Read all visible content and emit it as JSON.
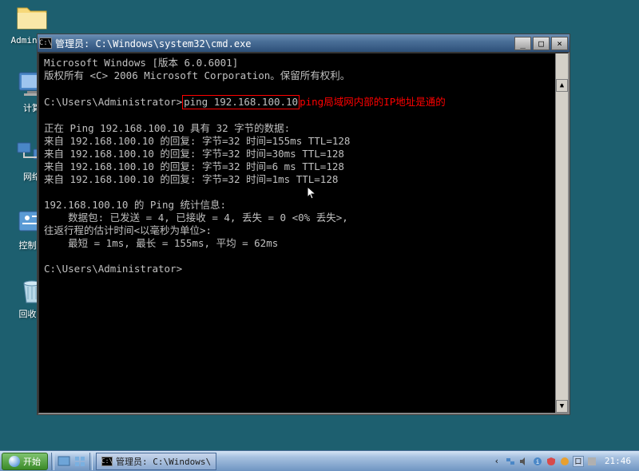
{
  "desktop_icons": [
    {
      "name": "administrator-folder-icon",
      "label": "Administ"
    },
    {
      "name": "computer-icon",
      "label": "计算"
    },
    {
      "name": "network-icon",
      "label": "网络"
    },
    {
      "name": "control-panel-icon",
      "label": "控制面"
    },
    {
      "name": "recycle-bin-icon",
      "label": "回收站"
    }
  ],
  "cmd": {
    "title": "管理员: C:\\Windows\\system32\\cmd.exe",
    "version_line": "Microsoft Windows [版本 6.0.6001]",
    "copyright_line": "版权所有 <C> 2006 Microsoft Corporation。保留所有权利。",
    "prompt1_path": "C:\\Users\\Administrator>",
    "prompt1_cmd": "ping 192.168.100.10",
    "annotation": "ping局域网内部的IP地址是通的",
    "ping_header": "正在 Ping 192.168.100.10 具有 32 字节的数据:",
    "replies": [
      "来自 192.168.100.10 的回复: 字节=32 时间=155ms TTL=128",
      "来自 192.168.100.10 的回复: 字节=32 时间=30ms TTL=128",
      "来自 192.168.100.10 的回复: 字节=32 时间=6 ms TTL=128",
      "来自 192.168.100.10 的回复: 字节=32 时间=1ms TTL=128"
    ],
    "stats_header": "192.168.100.10 的 Ping 统计信息:",
    "stats_packets": "    数据包: 已发送 = 4, 已接收 = 4, 丢失 = 0 <0% 丢失>,",
    "stats_rtt_header": "往返行程的估计时间<以毫秒为单位>:",
    "stats_rtt": "    最短 = 1ms, 最长 = 155ms, 平均 = 62ms",
    "prompt2": "C:\\Users\\Administrator>"
  },
  "window_buttons": {
    "min": "_",
    "max": "□",
    "close": "×"
  },
  "taskbar": {
    "start": "开始",
    "task_label": "管理员: C:\\Windows\\",
    "clock": "21:46"
  }
}
